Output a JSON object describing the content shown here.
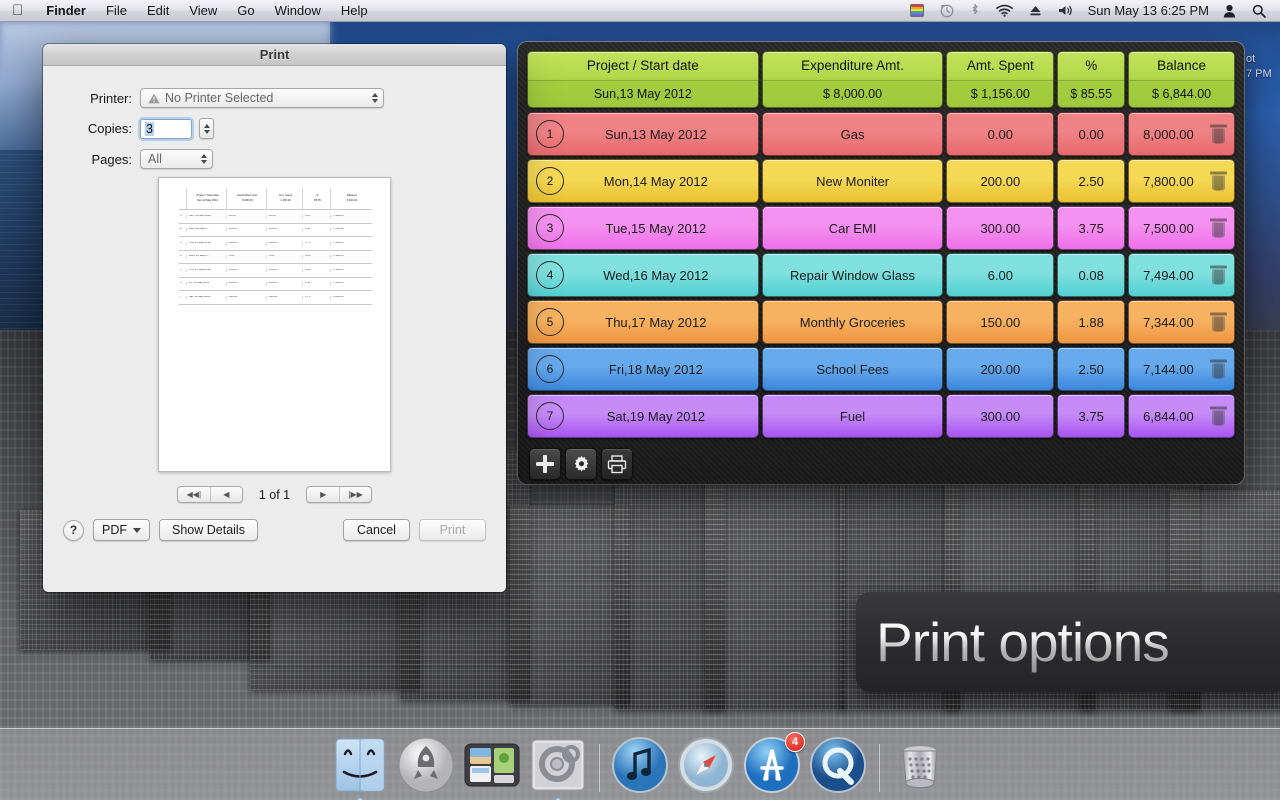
{
  "menubar": {
    "apple_icon": "apple-logo-icon",
    "items": [
      "Finder",
      "File",
      "Edit",
      "View",
      "Go",
      "Window",
      "Help"
    ],
    "status_icons": [
      "rainbow-app-icon",
      "time-machine-icon",
      "bluetooth-icon",
      "wifi-icon",
      "eject-icon",
      "volume-icon"
    ],
    "clock": "Sun May 13  6:25 PM",
    "user_icon": "user-account-icon",
    "search_icon": "spotlight-search-icon"
  },
  "print_dialog": {
    "title": "Print",
    "printer_label": "Printer:",
    "printer_value": "No Printer Selected",
    "printer_warning_icon": "warning-triangle-icon",
    "copies_label": "Copies:",
    "copies_value": "3",
    "pages_label": "Pages:",
    "pages_value": "All",
    "page_indicator": "1 of 1",
    "nav_first": "◀◀|",
    "nav_prev": "◀",
    "nav_next": "▶",
    "nav_last": "|▶▶",
    "help_label": "?",
    "pdf_label": "PDF",
    "details_label": "Show Details",
    "cancel_label": "Cancel",
    "print_label": "Print",
    "preview": {
      "headers": [
        "Project / Start date",
        "Expenditure Amt.",
        "Amt. Spent",
        "%",
        "Balance"
      ],
      "subheaders": [
        "Sun,13 May 2012",
        "8,000.00",
        "1,156.00",
        "85.55",
        "6,844.00"
      ],
      "rows": [
        {
          "n": "1",
          "date": "Sun, 13 May 2012",
          "exp": "12.00",
          "spent": "12.00",
          "pct": "0.15",
          "bal": "7,988.00"
        },
        {
          "n": "2",
          "date": "Mon, 14 May 2...",
          "exp": "200.00",
          "spent": "200.00",
          "pct": "2.50",
          "bal": "7,788.00"
        },
        {
          "n": "3",
          "date": "Tue, 15 May 2012",
          "exp": "300.00",
          "spent": "300.00",
          "pct": "3.75",
          "bal": "7,488.00"
        },
        {
          "n": "4",
          "date": "Wed, 16 May 2...",
          "exp": "6.00",
          "spent": "6.00",
          "pct": "0.08",
          "bal": "7,482.00"
        },
        {
          "n": "5",
          "date": "Thu, 17 May 2012",
          "exp": "150.00",
          "spent": "150.00",
          "pct": "1.88",
          "bal": "7,332.00"
        },
        {
          "n": "6",
          "date": "Fri, 18 May 2012",
          "exp": "200.00",
          "spent": "200.00",
          "pct": "2.50",
          "bal": "7,132.00"
        },
        {
          "n": "7",
          "date": "Sat, 19 May 2012",
          "exp": "300.00",
          "spent": "300.00",
          "pct": "3.75",
          "bal": "6,832.00"
        }
      ]
    }
  },
  "spreadsheet": {
    "header": {
      "columns": [
        "Project / Start date",
        "Expenditure Amt.",
        "Amt. Spent",
        "%",
        "Balance"
      ],
      "totals": [
        "Sun,13 May 2012",
        "$ 8,000.00",
        "$ 1,156.00",
        "$ 85.55",
        "$ 6,844.00"
      ],
      "color": "#b2d94b"
    },
    "rows": [
      {
        "num": "1",
        "date": "Sun,13 May 2012",
        "expenditure": "Gas",
        "spent": "0.00",
        "pct": "0.00",
        "balance": "8,000.00",
        "color": "#ef8285",
        "color2": "#e8696d"
      },
      {
        "num": "2",
        "date": "Mon,14 May 2012",
        "expenditure": "New Moniter",
        "spent": "200.00",
        "pct": "2.50",
        "balance": "7,800.00",
        "color": "#f5d955",
        "color2": "#e9c231"
      },
      {
        "num": "3",
        "date": "Tue,15 May 2012",
        "expenditure": "Car EMI",
        "spent": "300.00",
        "pct": "3.75",
        "balance": "7,500.00",
        "color": "#f490ef",
        "color2": "#ee6fe8"
      },
      {
        "num": "4",
        "date": "Wed,16 May 2012",
        "expenditure": "Repair Window Glass",
        "spent": "6.00",
        "pct": "0.08",
        "balance": "7,494.00",
        "color": "#7fe0de",
        "color2": "#52cfd2"
      },
      {
        "num": "5",
        "date": "Thu,17 May 2012",
        "expenditure": "Monthly Groceries",
        "spent": "150.00",
        "pct": "1.88",
        "balance": "7,344.00",
        "color": "#f6b260",
        "color2": "#ef9540"
      },
      {
        "num": "6",
        "date": "Fri,18 May 2012",
        "expenditure": "School Fees",
        "spent": "200.00",
        "pct": "2.50",
        "balance": "7,144.00",
        "color": "#66a9ec",
        "color2": "#3b87dd"
      },
      {
        "num": "7",
        "date": "Sat,19 May 2012",
        "expenditure": "Fuel",
        "spent": "300.00",
        "pct": "3.75",
        "balance": "6,844.00",
        "color": "#c58bf6",
        "color2": "#a954f2"
      }
    ],
    "toolbar": {
      "add_icon": "plus-icon",
      "settings_icon": "gear-icon",
      "print_icon": "printer-icon"
    },
    "delete_icon": "trash-icon"
  },
  "desktop_widget": {
    "line1": "ot",
    "line2": "7 PM"
  },
  "banner": {
    "text": "Print options"
  },
  "dock": {
    "items": [
      {
        "name": "finder",
        "label": "Finder"
      },
      {
        "name": "launchpad",
        "label": "Launchpad"
      },
      {
        "name": "mission-control",
        "label": "Mission Control"
      },
      {
        "name": "system-preferences",
        "label": "System Preferences"
      },
      {
        "name": "itunes",
        "label": "iTunes"
      },
      {
        "name": "safari",
        "label": "Safari"
      },
      {
        "name": "app-store",
        "label": "App Store",
        "badge": "4"
      },
      {
        "name": "quicktime",
        "label": "QuickTime Player"
      },
      {
        "name": "trash",
        "label": "Trash"
      }
    ],
    "app_store_badge": "4"
  }
}
